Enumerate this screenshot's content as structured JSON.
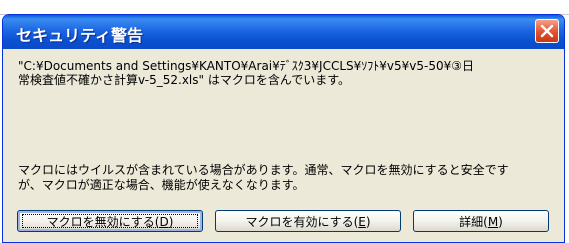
{
  "dialog": {
    "title": "セキュリティ警告",
    "message_line1": "\"C:¥Documents and Settings¥KANTO¥Arai¥ﾃﾞｽｸ3¥JCCLS¥ｿﾌﾄ¥v5¥v5-50¥③日",
    "message_line2": "常検査値不確かさ計算v-5_52.xls\" はマクロを含んでいます。",
    "warning_line1": "マクロにはウイルスが含まれている場合があります。通常、マクロを無効にすると安全です",
    "warning_line2": "が、マクロが適正な場合、機能が使えなくなります。"
  },
  "buttons": {
    "disable": {
      "label": "マクロを無効にする(",
      "key": "D",
      "suffix": ")"
    },
    "enable": {
      "label": "マクロを有効にする(",
      "key": "E",
      "suffix": ")"
    },
    "details": {
      "label": "詳細(",
      "key": "M",
      "suffix": ")"
    }
  },
  "icons": {
    "close": "close-icon"
  },
  "colors": {
    "titlebar": "#0a51d2",
    "close_button": "#e0522f",
    "dialog_background": "#ece9d8"
  }
}
